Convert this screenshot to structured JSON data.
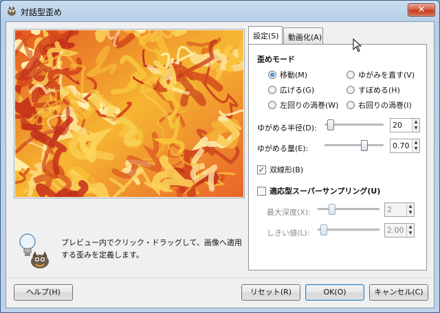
{
  "window": {
    "title": "対話型歪め",
    "close_label": "✕"
  },
  "hint": {
    "text": "プレビュー内でクリック・ドラッグして、画像へ適用する歪みを定義します。"
  },
  "tabs": [
    {
      "label": "設定(S)",
      "active": true
    },
    {
      "label": "動画化(A)",
      "active": false
    }
  ],
  "mode": {
    "title": "歪めモード",
    "options": [
      {
        "label": "移動(M)",
        "selected": true
      },
      {
        "label": "ゆがみを直す(V)",
        "selected": false
      },
      {
        "label": "広げる(G)",
        "selected": false
      },
      {
        "label": "すぼめる(H)",
        "selected": false
      },
      {
        "label": "左回りの渦巻(W)",
        "selected": false
      },
      {
        "label": "右回りの渦巻(I)",
        "selected": false
      }
    ]
  },
  "radius": {
    "label": "ゆがめる半径(D):",
    "value": "20",
    "fraction": 0.05
  },
  "amount": {
    "label": "ゆがめる量(E):",
    "value": "0.70",
    "fraction": 0.7
  },
  "bilinear": {
    "label": "双線形(B)",
    "checked": true
  },
  "supersampling": {
    "label": "適応型スーパーサンプリング(U)",
    "checked": false
  },
  "max_depth": {
    "label": "最大深度(X):",
    "value": "2",
    "fraction": 0.2
  },
  "threshold": {
    "label": "しきい値(L):",
    "value": "2.00",
    "fraction": 0.05
  },
  "buttons": {
    "help": "ヘルプ(H)",
    "reset": "リセット(R)",
    "ok": "OK(O)",
    "cancel": "キャンセル(C)"
  },
  "colors": {
    "preview_base": "#f7c23a",
    "preview_dark": "#d4491d",
    "preview_light": "#fff2b0"
  }
}
